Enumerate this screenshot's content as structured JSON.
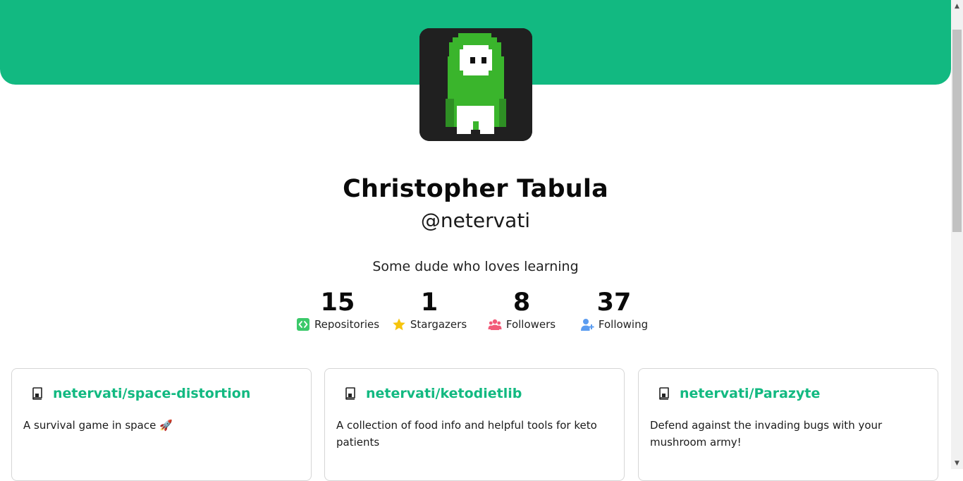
{
  "profile": {
    "name": "Christopher Tabula",
    "handle": "@netervati",
    "bio": "Some dude who loves learning"
  },
  "colors": {
    "accent": "#12b981",
    "avatar_bg": "#202020",
    "avatar_green": "#3ab52c"
  },
  "stats": [
    {
      "value": "15",
      "label": "Repositories",
      "icon": "code-icon"
    },
    {
      "value": "1",
      "label": "Stargazers",
      "icon": "star-icon"
    },
    {
      "value": "8",
      "label": "Followers",
      "icon": "users-icon"
    },
    {
      "value": "37",
      "label": "Following",
      "icon": "user-plus-icon"
    }
  ],
  "repos": [
    {
      "name": "netervati/space-distortion",
      "description": "A survival game in space 🚀",
      "icon": "repo-icon"
    },
    {
      "name": "netervati/ketodietlib",
      "description": "A collection of food info and helpful tools for keto patients",
      "icon": "repo-icon"
    },
    {
      "name": "netervati/Parazyte",
      "description": "Defend against the invading bugs with your mushroom army!",
      "icon": "repo-icon"
    }
  ]
}
